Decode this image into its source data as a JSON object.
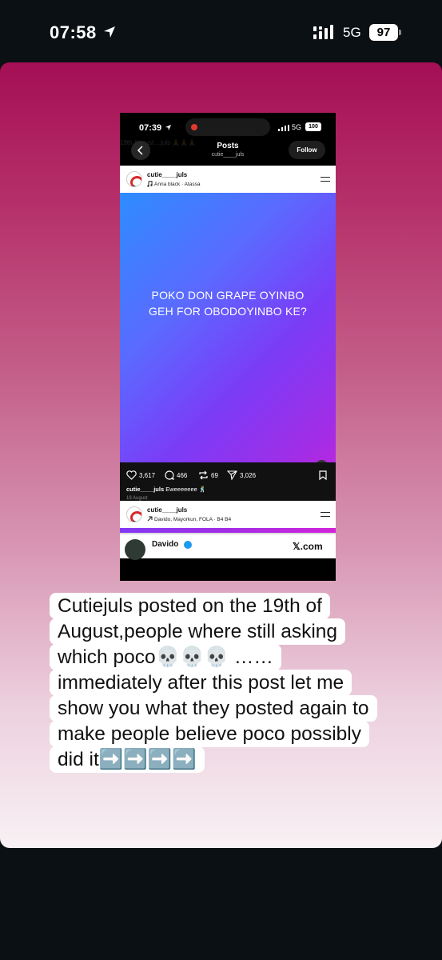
{
  "status_bar": {
    "time": "07:58",
    "network": "5G",
    "battery": "97"
  },
  "screenshot": {
    "status": {
      "time": "07:39",
      "network": "5G",
      "battery": "100"
    },
    "header": {
      "faded_text": "19th August ...juls 🙏🙏🙏",
      "title": "Posts",
      "subtitle": "cutie____juls",
      "follow_label": "Follow"
    },
    "post": {
      "username": "cutie____juls",
      "music": "Anna black · Atassa",
      "text_line1": "POKO DON GRAPE OYINBO",
      "text_line2": "GEH FOR OBODOYINBO KE?",
      "likes": "3,617",
      "comments": "466",
      "reposts": "69",
      "shares": "3,026",
      "caption_user": "cutie____juls",
      "caption_text": "Eweeeeeee 🕺",
      "date": "19 August"
    },
    "next_post": {
      "username": "cutie____juls",
      "meta": "Davido, Mayorkun, FOLA · B4 B4"
    },
    "preview": {
      "name": "Davido",
      "source": "𝕏.com"
    }
  },
  "story_text": "Cutiejuls posted on the 19th of August,people where still asking which poco💀💀💀 ……immediately after this post let me show you what they posted again to make people believe poco possibly did it➡️➡️➡️➡️"
}
